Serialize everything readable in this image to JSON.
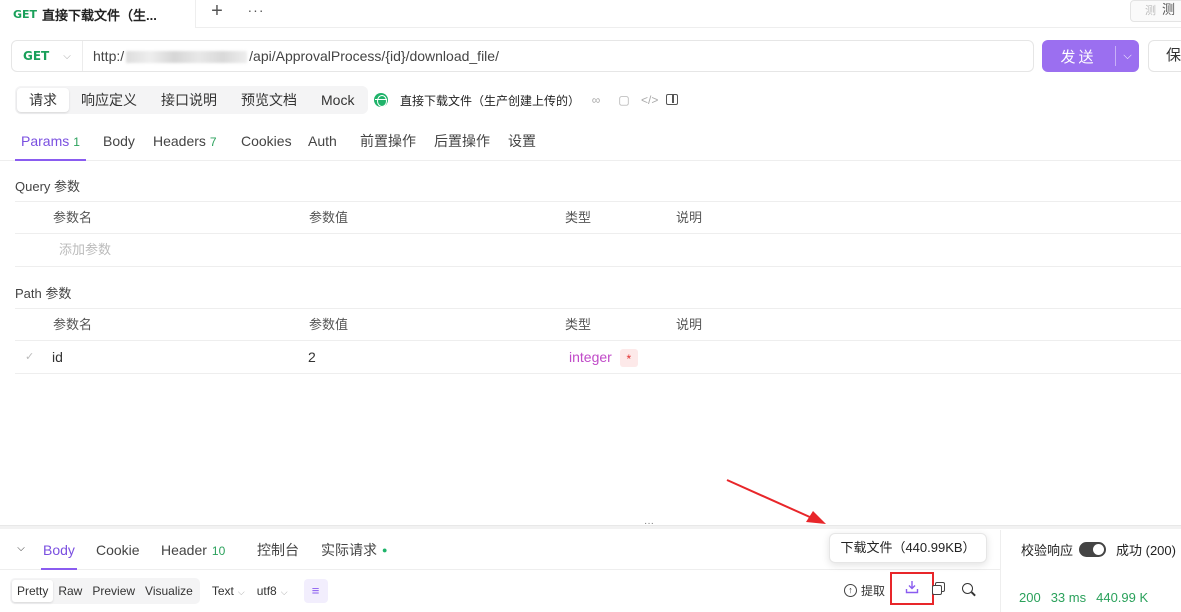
{
  "tabbar": {
    "active_tab": {
      "method": "GET",
      "title": "直接下载文件（生..."
    },
    "add_label": "+",
    "more_label": "···",
    "test_button": {
      "icon": "测",
      "label": "测"
    }
  },
  "request": {
    "method": "GET",
    "url_prefix": "http:/",
    "url_suffix": "/api/ApprovalProcess/{id}/download_file/",
    "send_label": "发送",
    "save_label": "保"
  },
  "subtabs": {
    "items": [
      "请求",
      "响应定义",
      "接口说明",
      "预览文档",
      "Mock"
    ],
    "active": "请求",
    "api_name": "直接下载文件（生产创建上传的）"
  },
  "param_tabs": {
    "params": {
      "label": "Params",
      "count": "1"
    },
    "body": "Body",
    "headers": {
      "label": "Headers",
      "count": "7"
    },
    "cookies": "Cookies",
    "auth": "Auth",
    "pre": "前置操作",
    "post": "后置操作",
    "settings": "设置"
  },
  "query": {
    "title": "Query 参数",
    "columns": {
      "name": "参数名",
      "value": "参数值",
      "type": "类型",
      "desc": "说明"
    },
    "add_placeholder": "添加参数"
  },
  "path": {
    "title": "Path 参数",
    "columns": {
      "name": "参数名",
      "value": "参数值",
      "type": "类型",
      "desc": "说明"
    },
    "rows": [
      {
        "name": "id",
        "value": "2",
        "type": "integer",
        "required_mark": "*"
      }
    ]
  },
  "response": {
    "tabs": {
      "body": "Body",
      "cookie": "Cookie",
      "header": {
        "label": "Header",
        "count": "10"
      },
      "console": "控制台",
      "actual": "实际请求"
    },
    "tooltip": "下载文件（440.99KB）",
    "validate_label": "校验响应",
    "success_label": "成功 (200)",
    "status": {
      "code": "200",
      "time": "33 ms",
      "size": "440.99 K"
    },
    "formats": [
      "Pretty",
      "Raw",
      "Preview",
      "Visualize"
    ],
    "active_format": "Pretty",
    "text_type": "Text",
    "encoding": "utf8",
    "extract_label": "提取"
  },
  "colors": {
    "accent": "#8a5cf0",
    "get_method": "#1aa05a",
    "type_color": "#c04ac8",
    "annotation": "#e8262a"
  }
}
